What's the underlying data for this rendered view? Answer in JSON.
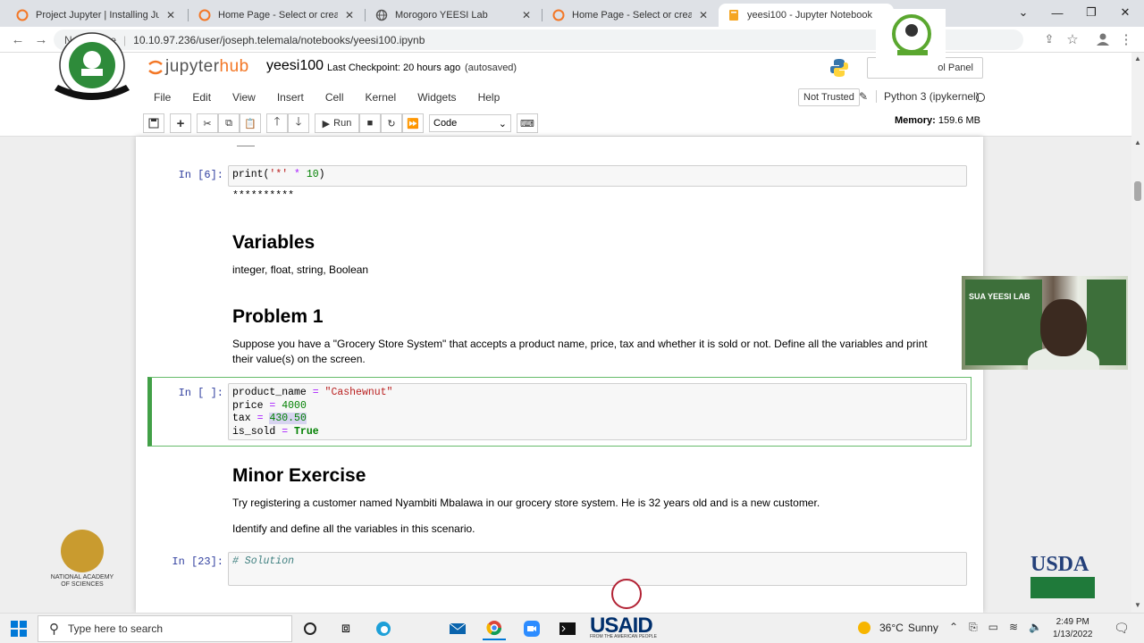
{
  "browser": {
    "tabs": [
      {
        "title": "Project Jupyter | Installing Jupyte",
        "close": "✕"
      },
      {
        "title": "Home Page - Select or create a n",
        "close": "✕"
      },
      {
        "title": "Morogoro YEESI Lab",
        "close": "✕"
      },
      {
        "title": "Home Page - Select or create a n",
        "close": "✕"
      },
      {
        "title": "yeesi100 - Jupyter Notebook",
        "close": "✕"
      }
    ],
    "security": "Not secure",
    "url": "10.10.97.236/user/joseph.telemala/notebooks/yeesi100.ipynb"
  },
  "jupyter": {
    "logo": "jupyter",
    "logo_hub": "hub",
    "notebook_name": "yeesi100",
    "checkpoint": "Last Checkpoint: 20 hours ago",
    "autosave": "(autosaved)",
    "control_panel": "ol Panel",
    "menu": [
      "File",
      "Edit",
      "View",
      "Insert",
      "Cell",
      "Kernel",
      "Widgets",
      "Help"
    ],
    "trust": "Not Trusted",
    "kernel": "Python 3 (ipykernel)",
    "run_label": "Run",
    "cell_type": "Code",
    "memory_label": "Memory:",
    "memory_value": "159.6 MB"
  },
  "cells": {
    "c6_prompt": "In [6]:",
    "c6_code": {
      "fn": "print",
      "open": "(",
      "str": "'*'",
      "op": " * ",
      "num": "10",
      "close": ")"
    },
    "c6_output": "**********",
    "h_variables": "Variables",
    "p_variables": "integer, float, string, Boolean",
    "h_problem": "Problem 1",
    "p_problem": "Suppose you have a \"Grocery Store System\" that accepts a product name, price, tax and whether it is sold or not. Define all the variables and print their value(s) on the screen.",
    "c_sel_prompt": "In [ ]:",
    "code_lines": [
      {
        "name": "product_name",
        "op": " = ",
        "val": "\"Cashewnut\"",
        "cls": "s"
      },
      {
        "name": "price",
        "op": " = ",
        "val": "4000",
        "cls": "n"
      },
      {
        "name": "tax",
        "op": " = ",
        "val": "430.50",
        "cls": "n"
      },
      {
        "name": "is_sold",
        "op": " = ",
        "val": "True",
        "cls": "k"
      }
    ],
    "h_minor": "Minor Exercise",
    "p_minor1": "Try registering a customer named Nyambiti Mbalawa in our grocery store system. He is 32 years old and is a new customer.",
    "p_minor2": "Identify and define all the variables in this scenario.",
    "c23_prompt": "In [23]:",
    "c23_code": "# Solution"
  },
  "logos": {
    "nas": "NATIONAL ACADEMY OF SCIENCES",
    "usda": "USDA",
    "usaid": "USAID",
    "usaid_sub": "FROM THE AMERICAN PEOPLE",
    "webcam_banner": "SUA YEESI LAB"
  },
  "taskbar": {
    "search": "Type here to search",
    "temperature": "36°C",
    "weather": "Sunny",
    "time": "2:49 PM",
    "date": "1/13/2022"
  }
}
